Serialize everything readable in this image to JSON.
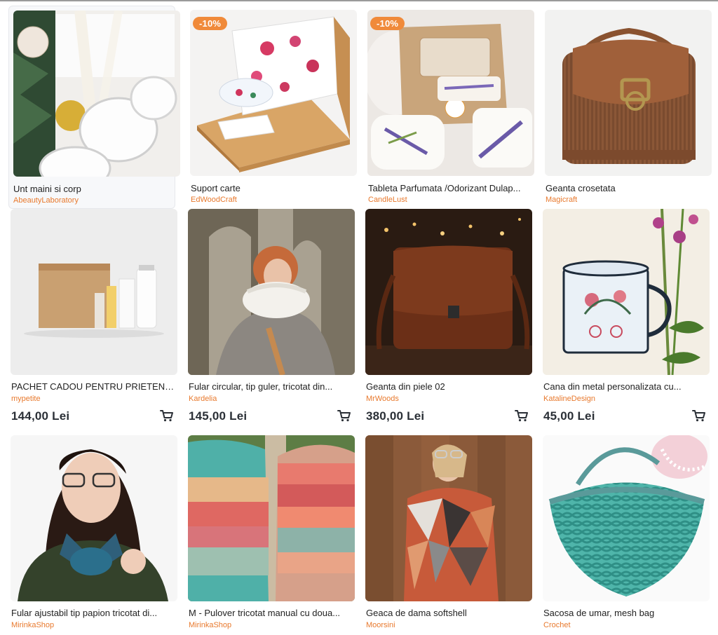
{
  "products": [
    {
      "id": "p1",
      "title": "Unt maini si corp",
      "shop": "AbeautyLaboratory",
      "badge": "",
      "price": "",
      "cart": false
    },
    {
      "id": "p2",
      "title": "Suport carte",
      "shop": "EdWoodCraft",
      "badge": "-10%",
      "price": "",
      "cart": false
    },
    {
      "id": "p3",
      "title": "Tableta Parfumata /Odorizant Dulap...",
      "shop": "CandleLust",
      "badge": "-10%",
      "price": "",
      "cart": false
    },
    {
      "id": "p4",
      "title": "Geanta crosetata",
      "shop": "Magicraft",
      "badge": "",
      "price": "",
      "cart": false
    },
    {
      "id": "p5",
      "title": "PACHET CADOU PENTRU PRIETENA...",
      "shop": "mypetite",
      "badge": "",
      "price": "144,00 Lei",
      "cart": true
    },
    {
      "id": "p6",
      "title": "Fular circular, tip guler, tricotat din...",
      "shop": "Kardelia",
      "badge": "",
      "price": "145,00 Lei",
      "cart": true
    },
    {
      "id": "p7",
      "title": "Geanta din piele 02",
      "shop": "MrWoods",
      "badge": "",
      "price": "380,00 Lei",
      "cart": true
    },
    {
      "id": "p8",
      "title": "Cana din metal personalizata cu...",
      "shop": "KatalineDesign",
      "badge": "",
      "price": "45,00 Lei",
      "cart": true
    },
    {
      "id": "p9",
      "title": "Fular ajustabil tip papion tricotat di...",
      "shop": "MirinkaShop",
      "badge": "",
      "price": "",
      "cart": false
    },
    {
      "id": "p10",
      "title": "M - Pulover tricotat manual cu doua...",
      "shop": "MirinkaShop",
      "badge": "",
      "price": "",
      "cart": false
    },
    {
      "id": "p11",
      "title": "Geaca de dama softshell",
      "shop": "Moorsini",
      "badge": "",
      "price": "",
      "cart": false
    },
    {
      "id": "p12",
      "title": "Sacosa de umar, mesh bag",
      "shop": "Crochet",
      "badge": "",
      "price": "",
      "cart": false
    }
  ],
  "icons": {
    "cart": "cart-icon"
  },
  "colors": {
    "shop_link": "#e8792d",
    "badge": "#f08a3a",
    "price": "#2a2f36"
  }
}
